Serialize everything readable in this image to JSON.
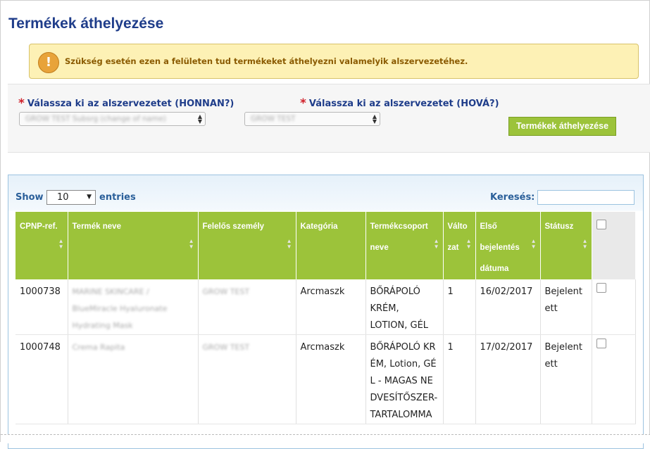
{
  "page": {
    "title": "Termékek áthelyezése"
  },
  "alert": {
    "icon": "warning-icon",
    "text": "Szükség esetén ezen a felületen tud termékeket áthelyezni valamelyik alszervezetéhez."
  },
  "filters": {
    "from_label": "Válassza ki az alszervezetet (HONNAN?)",
    "from_value": "GROW TEST Subsrg (change of name)",
    "to_label": "Válassza ki az alszervezetet (HOVÁ?)",
    "to_value": "GROW TEST",
    "required_mark": "*",
    "move_button": "Termékek áthelyezése"
  },
  "table_controls": {
    "show": "Show",
    "length": "10",
    "entries": "entries",
    "search_label": "Keresés:"
  },
  "table": {
    "headers": [
      "CPNP-ref.",
      "Termék neve",
      "Felelős személy",
      "Kategória",
      "Termékcsoport neve",
      "Változat",
      "Első bejelentés dátuma",
      "Státusz"
    ],
    "rows": [
      {
        "ref": "1000738",
        "name": "MARINE SKINCARE / BlueMiracle Hyaluronate Hydrating Mask",
        "person": "GROW TEST",
        "category": "Arcmaszk",
        "group": "BŐRÁPOLÓ KRÉM, LOTION, GÉL",
        "version": "1",
        "date": "16/02/2017",
        "status": "Bejelentett"
      },
      {
        "ref": "1000748",
        "name": "Crema Rapita",
        "person": "GROW TEST",
        "category": "Arcmaszk",
        "group": "BŐRÁPOLÓ KRÉM, Lotion, GÉL - MAGAS NEDVESÍTŐSZER-TARTALOMMA",
        "version": "1",
        "date": "17/02/2017",
        "status": "Bejelentett"
      }
    ]
  },
  "colors": {
    "accent": "#9cc33a",
    "title": "#1f3d8a",
    "alert_bg": "#fdf1b5"
  }
}
